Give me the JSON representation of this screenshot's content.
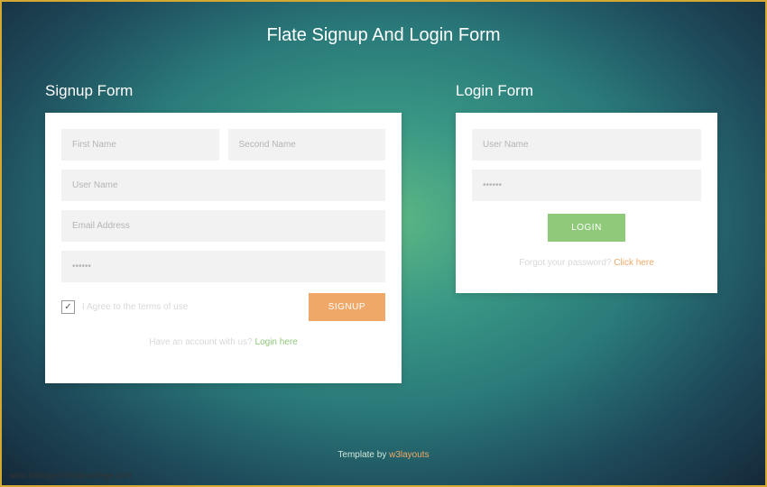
{
  "page_title": "Flate Signup And Login Form",
  "signup": {
    "heading": "Signup Form",
    "first_name_placeholder": "First Name",
    "second_name_placeholder": "Second Name",
    "user_name_placeholder": "User Name",
    "email_placeholder": "Email Address",
    "password_placeholder": "••••••",
    "agree_label": "I Agree to the terms of use",
    "checkbox_checked": "✓",
    "submit_label": "SIGNUP",
    "helper_text": "Have an account with us? ",
    "helper_link": "Login here"
  },
  "login": {
    "heading": "Login Form",
    "user_name_placeholder": "User Name",
    "password_placeholder": "••••••",
    "submit_label": "LOGIN",
    "forgot_text": "Forgot your password? ",
    "forgot_link": "Click here"
  },
  "footer": {
    "text": "Template by ",
    "link": "w3layouts"
  },
  "watermark": "www.heritagechristiancollege.com"
}
